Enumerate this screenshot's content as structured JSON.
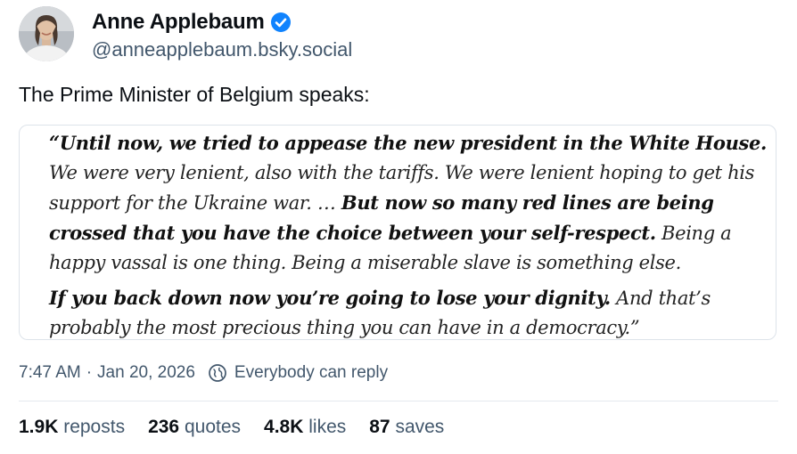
{
  "author": {
    "display_name": "Anne Applebaum",
    "handle": "@anneapplebaum.bsky.social",
    "verified_icon": "verified-check-icon",
    "verified_color": "#1083fe"
  },
  "post": {
    "text": "The Prime Minister of Belgium speaks:",
    "quote": {
      "p1_bold_a": "“Until now, we tried to appease the new president in the White House.",
      "p1_regular_a": " We were very lenient, also with the tariffs. We were lenient hoping to get his support for the Ukraine war. … ",
      "p1_bold_b": "But now so many red lines are being crossed that you have the choice between your self-respect.",
      "p1_regular_b": " Being a happy vassal is one thing. Being a miserable slave is something else.",
      "p2_bold": "If you back down now you’re going to lose your dignity.",
      "p2_regular": " And that’s probably the most precious thing you can have in a democracy.”"
    },
    "time": "7:47 AM",
    "date": "Jan 20, 2026",
    "separator": "·",
    "reply_setting": "Everybody can reply",
    "reply_setting_icon": "globe-icon"
  },
  "stats": {
    "reposts_count": "1.9K",
    "reposts_label": "reposts",
    "quotes_count": "236",
    "quotes_label": "quotes",
    "likes_count": "4.8K",
    "likes_label": "likes",
    "saves_count": "87",
    "saves_label": "saves"
  },
  "colors": {
    "text_primary": "#0b0f14",
    "text_secondary": "#42576c",
    "border": "#dde3ea"
  }
}
